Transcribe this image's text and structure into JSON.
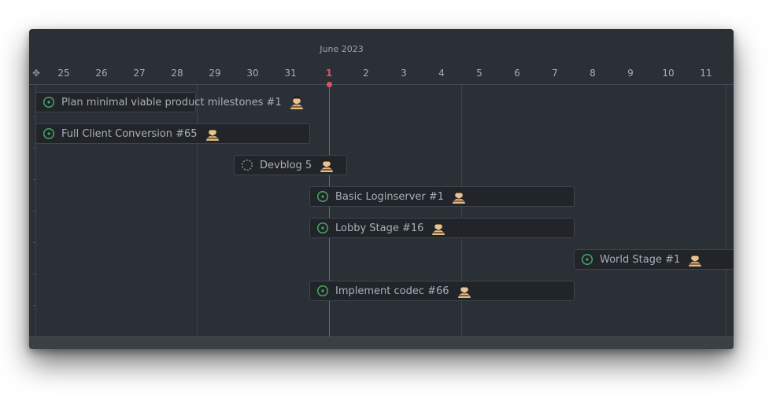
{
  "timeline": {
    "month_label": "June 2023",
    "today_label": "1",
    "days": [
      "25",
      "26",
      "27",
      "28",
      "29",
      "30",
      "31",
      "1",
      "2",
      "3",
      "4",
      "5",
      "6",
      "7",
      "8",
      "9",
      "10",
      "11"
    ]
  },
  "colors": {
    "panel_bg": "#2b2f36",
    "bar_bg": "#212429",
    "status_open": "#4aa563",
    "status_draft": "#8c939d",
    "today": "#e0525f"
  },
  "tasks": [
    {
      "title": "Plan minimal viable product milestones #1",
      "status": "open-issue-icon"
    },
    {
      "title": "Full Client Conversion #65",
      "status": "open-issue-icon"
    },
    {
      "title": "Devblog 5",
      "status": "draft-issue-icon"
    },
    {
      "title": "Basic Loginserver #1",
      "status": "open-issue-icon"
    },
    {
      "title": "Lobby Stage #16",
      "status": "open-issue-icon"
    },
    {
      "title": "World Stage #1",
      "status": "open-issue-icon"
    },
    {
      "title": "Implement codec #66",
      "status": "open-issue-icon"
    }
  ]
}
